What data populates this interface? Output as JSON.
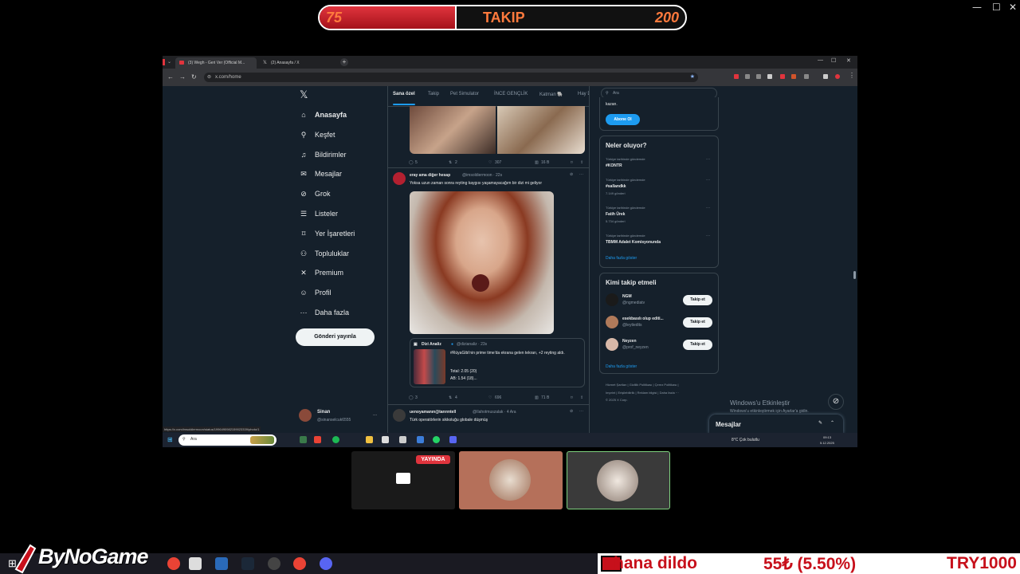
{
  "overlay": {
    "follow_current": "75",
    "follow_label": "TAKIP",
    "follow_goal": "200",
    "follow_progress": 0.375
  },
  "browser": {
    "tabs": [
      {
        "label": "(3) Wegh - Geri Ver (Official M..."
      },
      {
        "label": "(2) Anasayfa / X"
      }
    ],
    "url": "x.com/home",
    "status_url": "https://x.com/imsoldiermoon/status/1996490982159023339/photo/1"
  },
  "sidebar": {
    "items": [
      {
        "label": "Anasayfa",
        "icon": "home-icon",
        "glyph": "⌂"
      },
      {
        "label": "Keşfet",
        "icon": "search-icon",
        "glyph": "⚲"
      },
      {
        "label": "Bildirimler",
        "icon": "bell-icon",
        "glyph": "♫"
      },
      {
        "label": "Mesajlar",
        "icon": "mail-icon",
        "glyph": "✉"
      },
      {
        "label": "Grok",
        "icon": "grok-icon",
        "glyph": "⊘"
      },
      {
        "label": "Listeler",
        "icon": "list-icon",
        "glyph": "☰"
      },
      {
        "label": "Yer İşaretleri",
        "icon": "bookmark-icon",
        "glyph": "⌑"
      },
      {
        "label": "Topluluklar",
        "icon": "people-icon",
        "glyph": "⚇"
      },
      {
        "label": "Premium",
        "icon": "x-icon",
        "glyph": "✕"
      },
      {
        "label": "Profil",
        "icon": "person-icon",
        "glyph": "☺"
      },
      {
        "label": "Daha fazla",
        "icon": "more-icon",
        "glyph": "⋯"
      }
    ],
    "post_button": "Gönderi yayınla",
    "user_name": "Sinan",
    "user_handle": "@sinanselcuk6555"
  },
  "feed": {
    "tabs": [
      "Sana özel",
      "Takip",
      "Pet Simulator",
      "İNCE GENÇLİK",
      "Katman 🐘",
      "Hay D"
    ],
    "post1_stats": [
      "5",
      "2",
      "307",
      "16 B"
    ],
    "post2": {
      "author": "eray ama diğer hesap",
      "handle": "@imsoldiermoon · 22s",
      "text": "Yoksa uzun zaman sonra reyting kaygısı yaşamayacağım bir dizi mi geliyor",
      "quote_author": "Dizi Analiz",
      "quote_handle": "@dizianaliz · 23s",
      "quote_text": "#RüyaGibi'nin prime time'da ekrana gelen tekrarı, +2 reyting aldı.",
      "quote_total": "Total: 2.05 (20)",
      "quote_ab": "AB: 1.54 (18)...",
      "stats": [
        "3",
        "4",
        "696",
        "71 B"
      ]
    },
    "post3": {
      "author": "uenoyamanın@tanrıntell",
      "handle": "@Ilahotmuszalak · 4 Ara",
      "text": "Türk operatörlerin sikkoluğu globale düşmüş"
    }
  },
  "right": {
    "search_placeholder": "Ara",
    "premium_text": "kazan.",
    "subscribe": "Abone Ol",
    "trends_title": "Neler oluyor?",
    "trends": [
      {
        "ctx": "Türkiye tarihinde gündemde",
        "name": "#KONTR",
        "count": ""
      },
      {
        "ctx": "Türkiye tarihinde gündemde",
        "name": "#sallandkk",
        "count": "7.149 gönderi"
      },
      {
        "ctx": "Türkiye tarihinde gündemde",
        "name": "Fatih Ürek",
        "count": "5.734 gönderi"
      },
      {
        "ctx": "Türkiye tarihinde gündemde",
        "name": "TBMM Adalet Komisyonunda",
        "count": ""
      }
    ],
    "show_more": "Daha fazla göster",
    "who_title": "Kimi takip etmeli",
    "who": [
      {
        "name": "NGM",
        "handle": "@ngmediatv",
        "btn": "Takip et"
      },
      {
        "name": "esekbasılı olup editi...",
        "handle": "@leytiedits",
        "btn": "Takip et"
      },
      {
        "name": "Neyzen",
        "handle": "@prof_neyzen",
        "btn": "Takip et"
      }
    ],
    "who_more": "Daha fazla göster",
    "footer1": "Hizmet Şartları  |  Gizlilik Politikası  |  Çerez Politikası  |",
    "footer2": "Imprint  |  Erişilebilirlik  |  Reklam bilgisi  |  Daha fazla ···",
    "footer3": "© 2025 X Corp.",
    "messages": "Mesajlar",
    "activate1": "Windows'u Etkinleştir",
    "activate2": "Windows'u etkinleştirmek için Ayarlar'a gidin."
  },
  "inner_taskbar": {
    "search": "Ara",
    "weather": "8°C  Çok bulutlu",
    "time": "09:13",
    "date": "5.12.2025"
  },
  "cams": {
    "live_badge": "YAYINDA"
  },
  "bottom": {
    "logo": "ByNoGame",
    "ticker_name": "hana dildo",
    "ticker_amount": "55₺ (5.50%)",
    "ticker_goal": "TRY1000"
  }
}
